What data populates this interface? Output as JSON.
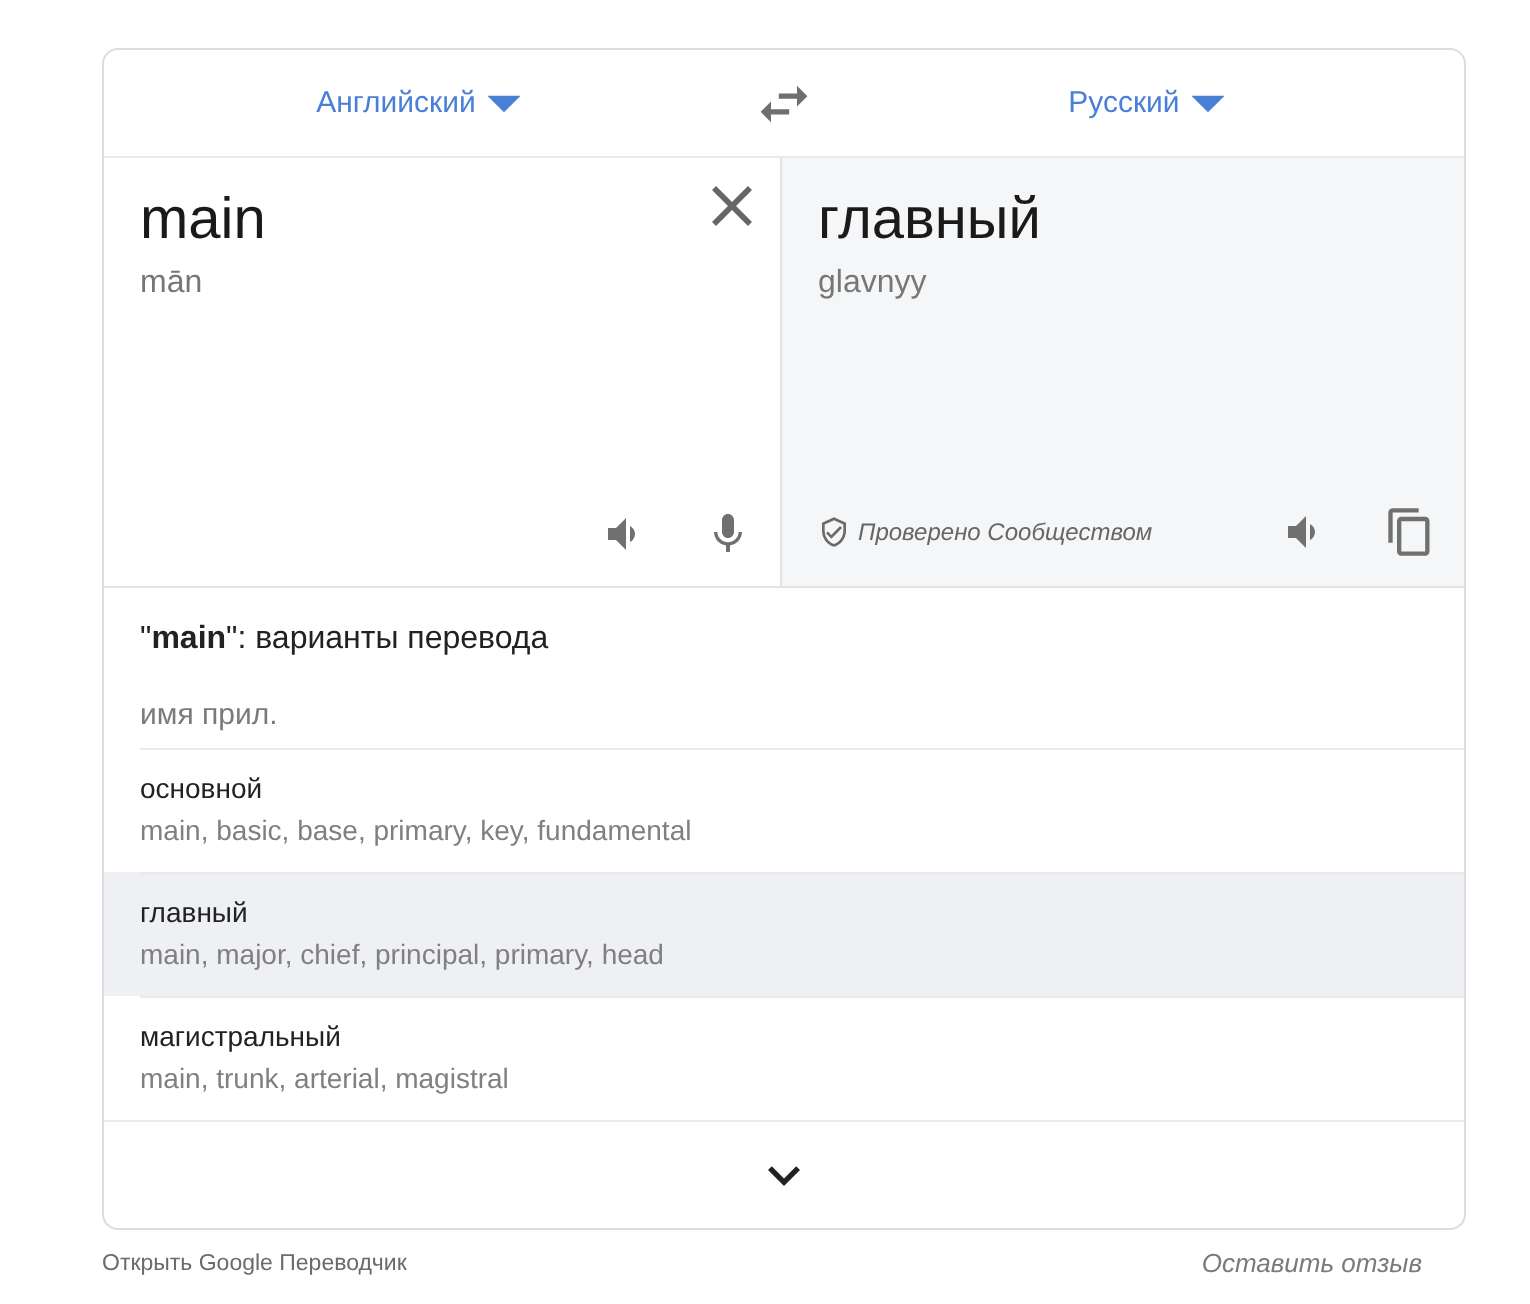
{
  "language_bar": {
    "source_language": "Английский",
    "target_language": "Русский"
  },
  "source": {
    "text": "main",
    "transliteration": "mān"
  },
  "target": {
    "text": "главный",
    "transliteration": "glavnyy",
    "verified_label": "Проверено Сообществом"
  },
  "dictionary": {
    "heading": "\"**main**\": варианты перевода",
    "part_of_speech": "имя прил.",
    "entries": [
      {
        "term": "основной",
        "synonyms": "main, basic, base, primary, key, fundamental",
        "highlighted": false
      },
      {
        "term": "главный",
        "synonyms": "main, major, chief, principal, primary, head",
        "highlighted": true
      },
      {
        "term": "магистральный",
        "synonyms": "main, trunk, arterial, magistral",
        "highlighted": false
      }
    ]
  },
  "footer": {
    "open_link": "Открыть Google Переводчик",
    "feedback_link": "Оставить отзыв"
  }
}
